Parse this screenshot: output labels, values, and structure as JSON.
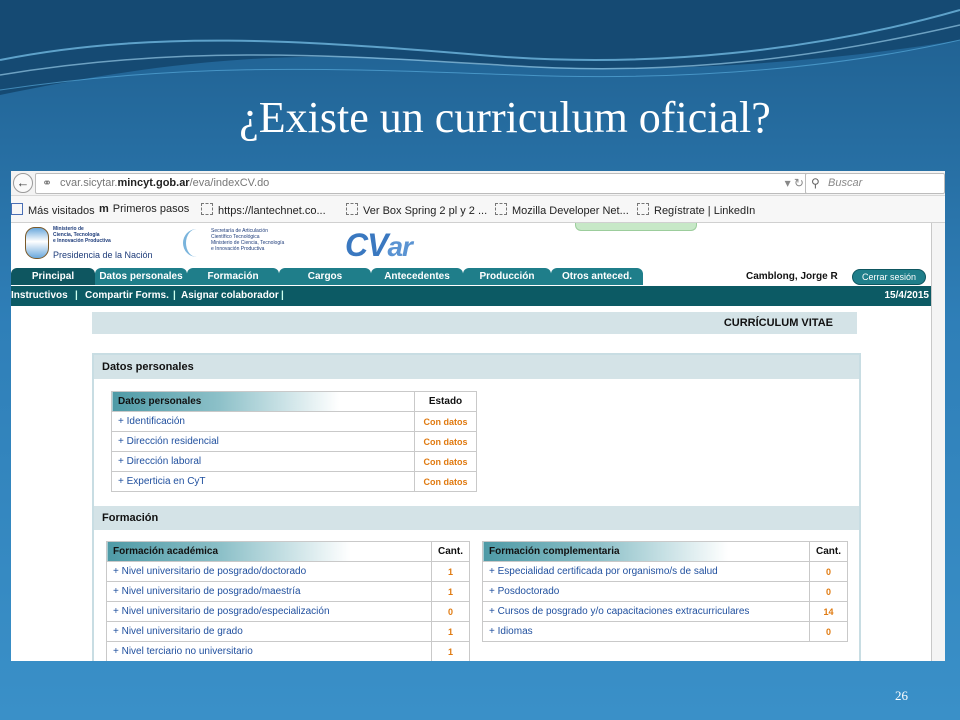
{
  "slide": {
    "title": "¿Existe un curriculum oficial?",
    "number": "26"
  },
  "browser": {
    "url_prefix": "cvar.sicytar.",
    "url_domain": "mincyt.gob.ar",
    "url_path": "/eva/indexCV.do",
    "search_placeholder": "Buscar",
    "bookmarks": [
      "Más visitados",
      "Primeros pasos",
      "https://lantechnet.co...",
      "Ver Box Spring 2 pl y 2 ...",
      "Mozilla Developer Net...",
      "Regístrate | LinkedIn"
    ]
  },
  "site": {
    "logo1_lines": "Ministerio de\nCiencia, Tecnología\ne Innovación Productiva",
    "logo1_presidencia": "Presidencia de la Nación",
    "logo2_lines": "Secretaría de Articulación\nCientífico Tecnológica\nMinisterio de Ciencia, Tecnología\ne Innovación Productiva",
    "logo_cv": "CV",
    "logo_ar": "ar",
    "tabs": [
      "Principal",
      "Datos personales",
      "Formación",
      "Cargos",
      "Antecedentes",
      "Producción",
      "Otros anteced."
    ],
    "user": "Camblong, Jorge R",
    "logout": "Cerrar sesión",
    "subnav": [
      "Instructivos",
      "Compartir Forms.",
      "Asignar colaborador"
    ],
    "date": "15/4/2015",
    "cv_title": "CURRÍCULUM VITAE"
  },
  "datos": {
    "section": "Datos personales",
    "header": "Datos personales",
    "status_header": "Estado",
    "rows": [
      {
        "label": "+ Identificación",
        "status": "Con datos"
      },
      {
        "label": "+ Dirección residencial",
        "status": "Con datos"
      },
      {
        "label": "+ Dirección laboral",
        "status": "Con datos"
      },
      {
        "label": "+ Experticia en CyT",
        "status": "Con datos"
      }
    ]
  },
  "formacion": {
    "section": "Formación",
    "academica": {
      "header": "Formación académica",
      "cant": "Cant.",
      "rows": [
        {
          "label": "+ Nivel universitario de posgrado/doctorado",
          "count": "1"
        },
        {
          "label": "+ Nivel universitario de posgrado/maestría",
          "count": "1"
        },
        {
          "label": "+ Nivel universitario de posgrado/especialización",
          "count": "0"
        },
        {
          "label": "+ Nivel universitario de grado",
          "count": "1"
        },
        {
          "label": "+ Nivel terciario no universitario",
          "count": "1"
        }
      ]
    },
    "complementaria": {
      "header": "Formación complementaria",
      "cant": "Cant.",
      "rows": [
        {
          "label": "+ Especialidad certificada por organismo/s de salud",
          "count": "0"
        },
        {
          "label": "+ Posdoctorado",
          "count": "0"
        },
        {
          "label": "+ Cursos de posgrado y/o capacitaciones extracurriculares",
          "count": "14"
        },
        {
          "label": "+ Idiomas",
          "count": "0"
        }
      ]
    }
  }
}
